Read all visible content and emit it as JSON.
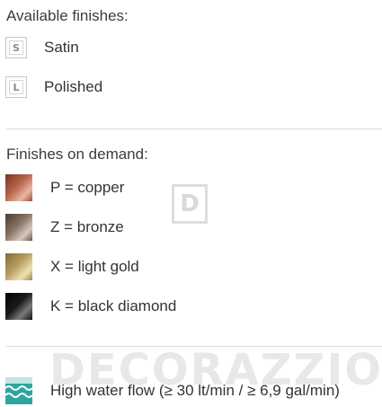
{
  "available": {
    "heading": "Available finishes:",
    "items": [
      {
        "letter": "S",
        "label": "Satin"
      },
      {
        "letter": "L",
        "label": "Polished"
      }
    ]
  },
  "on_demand": {
    "heading": "Finishes on demand:",
    "items": [
      {
        "label": "P = copper",
        "icon": "copper-swatch",
        "color": "#a5533d"
      },
      {
        "label": "Z = bronze",
        "icon": "bronze-swatch",
        "color": "#7a6558"
      },
      {
        "label": "X = light gold",
        "icon": "light-gold-swatch",
        "color": "#b39a55"
      },
      {
        "label": "K = black diamond",
        "icon": "black-diamond-swatch",
        "color": "#1a1a1a"
      }
    ]
  },
  "flow": {
    "label": "High water flow (≥ 30 lt/min / ≥ 6,9 gal/min)",
    "icon": "water-flow-icon",
    "color": "#2fa5a0"
  },
  "watermark": {
    "logo_letter": "D",
    "text": "DECORAZZIO"
  }
}
